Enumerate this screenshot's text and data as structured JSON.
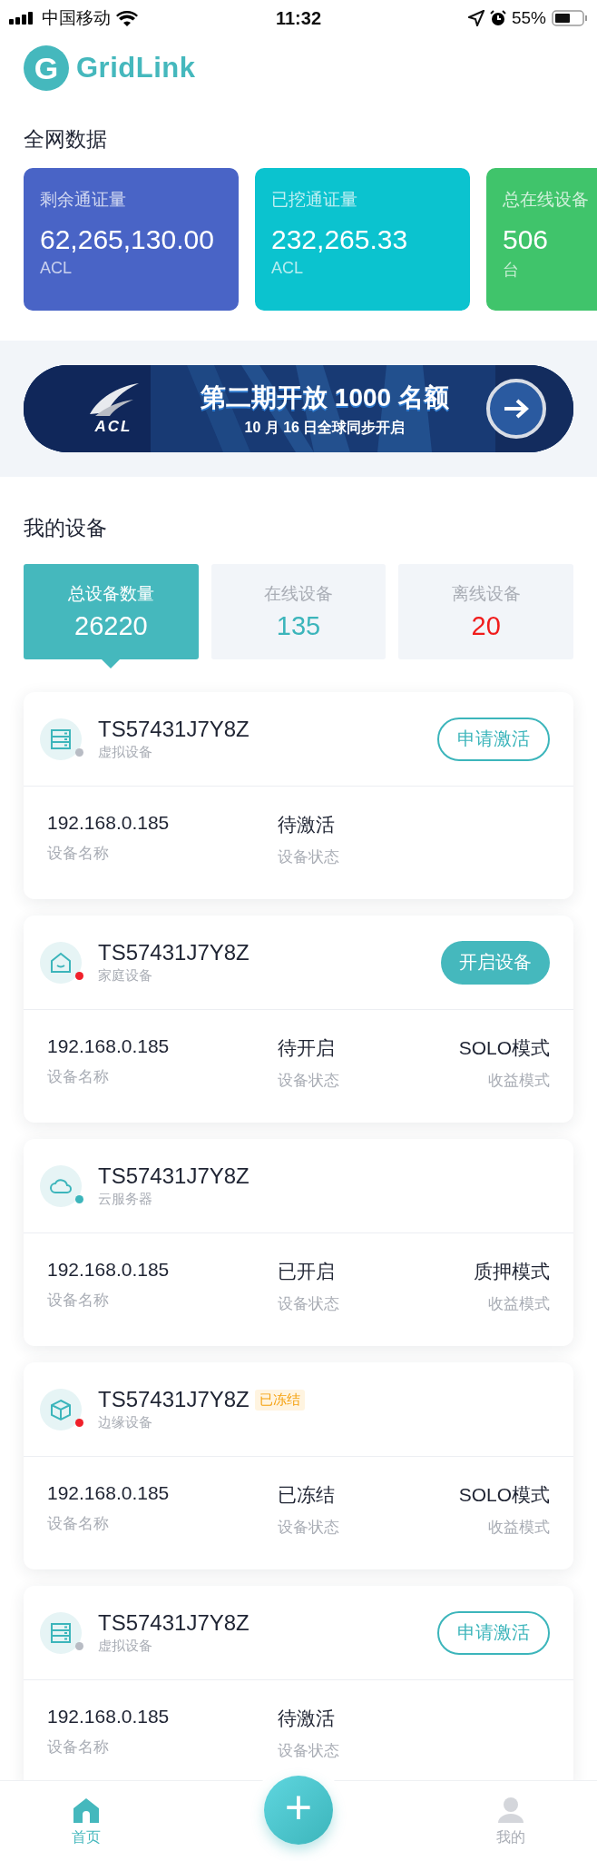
{
  "status_bar": {
    "carrier": "中国移动",
    "time": "11:32",
    "battery": "55%"
  },
  "logo": {
    "mark": "G",
    "name": "GridLink"
  },
  "network": {
    "title": "全网数据",
    "stats": [
      {
        "label": "剩余通证量",
        "value": "62,265,130.00",
        "unit": "ACL",
        "color": "#4964c6"
      },
      {
        "label": "已挖通证量",
        "value": "232,265.33",
        "unit": "ACL",
        "color": "#0bc3cf"
      },
      {
        "label": "总在线设备",
        "value": "506",
        "unit": "台",
        "color": "#40c46b"
      }
    ]
  },
  "banner": {
    "logo_text": "ACL",
    "title": "第二期开放 1000 名额",
    "subtitle": "10 月 16 日全球同步开启"
  },
  "my_devices": {
    "title": "我的设备",
    "tabs": [
      {
        "label": "总设备数量",
        "value": "26220",
        "selected": true,
        "color": "#ffffff"
      },
      {
        "label": "在线设备",
        "value": "135",
        "selected": false,
        "color": "#3cb5bb"
      },
      {
        "label": "离线设备",
        "value": "20",
        "selected": false,
        "color": "#f01c1c"
      }
    ],
    "devices": [
      {
        "id": "TS57431J7Y8Z",
        "type": "虚拟设备",
        "kind": "server",
        "color": "#b8bcc4",
        "action": {
          "label": "申请激活",
          "kind": "outline"
        },
        "fields": [
          {
            "value": "192.168.0.185",
            "label": "设备名称"
          },
          {
            "value": "待激活",
            "label": "设备状态"
          }
        ]
      },
      {
        "id": "TS57431J7Y8Z",
        "type": "家庭设备",
        "kind": "home",
        "color": "#f0202a",
        "action": {
          "label": "开启设备",
          "kind": "filled"
        },
        "fields": [
          {
            "value": "192.168.0.185",
            "label": "设备名称"
          },
          {
            "value": "待开启",
            "label": "设备状态"
          },
          {
            "value": "SOLO模式",
            "label": "收益模式"
          }
        ]
      },
      {
        "id": "TS57431J7Y8Z",
        "type": "云服务器",
        "kind": "cloud",
        "color": "#3cb5bb",
        "fields": [
          {
            "value": "192.168.0.185",
            "label": "设备名称"
          },
          {
            "value": "已开启",
            "label": "设备状态"
          },
          {
            "value": "质押模式",
            "label": "收益模式"
          }
        ]
      },
      {
        "id": "TS57431J7Y8Z",
        "badge": "已冻结",
        "type": "边缘设备",
        "kind": "edge",
        "color": "#f0202a",
        "fields": [
          {
            "value": "192.168.0.185",
            "label": "设备名称"
          },
          {
            "value": "已冻结",
            "label": "设备状态"
          },
          {
            "value": "SOLO模式",
            "label": "收益模式"
          }
        ]
      },
      {
        "id": "TS57431J7Y8Z",
        "type": "虚拟设备",
        "kind": "server",
        "color": "#b8bcc4",
        "action": {
          "label": "申请激活",
          "kind": "outline"
        },
        "fields": [
          {
            "value": "192.168.0.185",
            "label": "设备名称"
          },
          {
            "value": "待激活",
            "label": "设备状态"
          }
        ]
      }
    ]
  },
  "bottom_nav": {
    "fab": "+",
    "items": [
      {
        "label": "首页",
        "kind": "home",
        "selected": true
      },
      {
        "label": "我的",
        "kind": "profile",
        "selected": false
      }
    ]
  }
}
